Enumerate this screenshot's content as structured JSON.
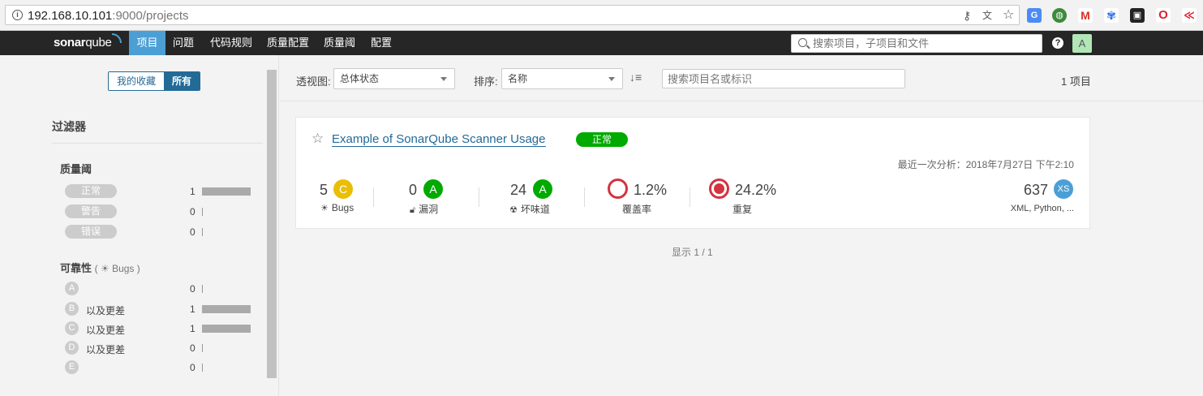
{
  "browser": {
    "url_host": "192.168.10.101",
    "url_path": ":9000/projects",
    "icons": [
      "info-icon",
      "key-icon",
      "translate-icon",
      "bookmark-star-icon"
    ],
    "extensions": [
      "google-translate-icon",
      "globe-extension-icon",
      "gmail-icon",
      "baidu-icon",
      "panda-icon",
      "opera-icon",
      "arrow-extension-icon"
    ]
  },
  "nav": {
    "logo_bold": "sonar",
    "logo_light": "qube",
    "items": [
      "项目",
      "问题",
      "代码规则",
      "质量配置",
      "质量阈",
      "配置"
    ],
    "active_index": 0,
    "search_placeholder": "搜索项目，子项目和文件",
    "help": "?",
    "avatar": "A"
  },
  "sidebar": {
    "toggle": [
      "我的收藏",
      "所有"
    ],
    "toggle_active_index": 1,
    "filter_title": "过滤器",
    "quality_gate": {
      "title": "质量阈",
      "items": [
        {
          "label": "正常",
          "count": "1",
          "fraction": 1
        },
        {
          "label": "警告",
          "count": "0",
          "fraction": 0
        },
        {
          "label": "错误",
          "count": "0",
          "fraction": 0
        }
      ]
    },
    "reliability": {
      "title": "可靠性",
      "subtitle": "( ☀ Bugs )",
      "items": [
        {
          "grade": "A",
          "label": "",
          "count": "0",
          "fraction": 0
        },
        {
          "grade": "B",
          "label": "以及更差",
          "count": "1",
          "fraction": 1
        },
        {
          "grade": "C",
          "label": "以及更差",
          "count": "1",
          "fraction": 1
        },
        {
          "grade": "D",
          "label": "以及更差",
          "count": "0",
          "fraction": 0
        },
        {
          "grade": "E",
          "label": "",
          "count": "0",
          "fraction": 0
        }
      ]
    }
  },
  "toolbar": {
    "perspective_label": "透视图:",
    "perspective_value": "总体状态",
    "sort_label": "排序:",
    "sort_value": "名称",
    "sort_icon": "↓≡",
    "search_placeholder": "搜索项目名或标识",
    "count": "1 项目"
  },
  "project": {
    "name": "Example of SonarQube Scanner Usage",
    "quality_gate": "正常",
    "last_analysis": "最近一次分析：2018年7月27日 下午2:10",
    "metrics": {
      "bugs": {
        "value": "5",
        "grade": "C",
        "label": "Bugs",
        "icon": "bug-icon"
      },
      "vulnerabilities": {
        "value": "0",
        "grade": "A",
        "label": "漏洞",
        "icon": "lock-icon"
      },
      "code_smells": {
        "value": "24",
        "grade": "A",
        "label": "坏味道",
        "icon": "radiation-icon"
      },
      "coverage": {
        "value": "1.2%",
        "label": "覆盖率"
      },
      "duplications": {
        "value": "24.2%",
        "label": "重复"
      },
      "size": {
        "value": "637",
        "badge": "XS",
        "languages": "XML, Python, ..."
      }
    }
  },
  "pager": "显示 1 / 1",
  "colors": {
    "brand_blue": "#4b9fd5",
    "dark_blue": "#236a97",
    "grade_a": "#00aa00",
    "grade_c": "#eabe06",
    "error_red": "#d4333f",
    "nav_bg": "#262626"
  }
}
